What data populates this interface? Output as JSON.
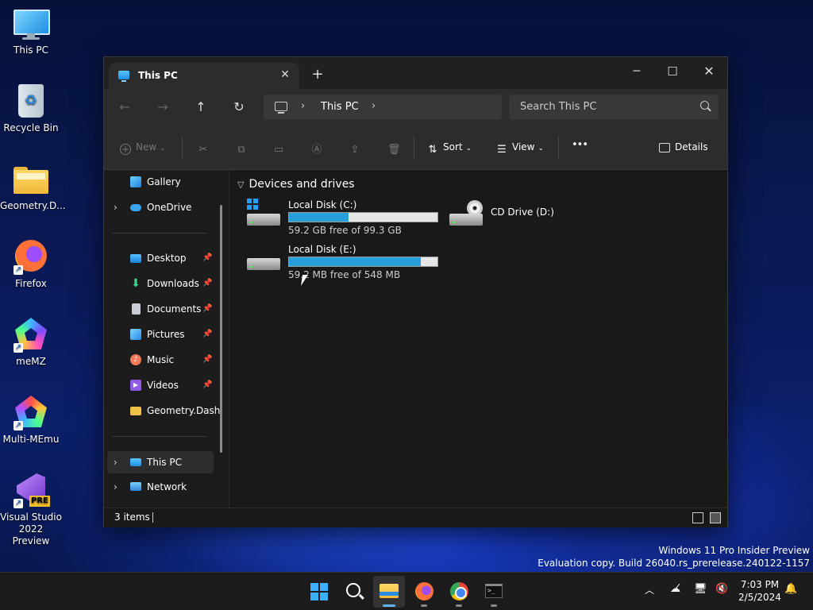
{
  "desktop": {
    "icons": [
      {
        "label": "This PC"
      },
      {
        "label": "Recycle Bin"
      },
      {
        "label": "Geometry.D..."
      },
      {
        "label": "Firefox"
      },
      {
        "label": "meMZ"
      },
      {
        "label": "Multi-MEmu"
      },
      {
        "label": "Visual Studio 2022 Preview",
        "badge": "PRE"
      }
    ],
    "watermark": {
      "line1": "Windows 11 Pro Insider Preview",
      "line2": "Evaluation copy. Build 26040.rs_prerelease.240122-1157"
    }
  },
  "window": {
    "tab_title": "This PC",
    "tab_close": "✕",
    "new_tab": "+",
    "controls": {
      "minimize": "─",
      "maximize": "☐",
      "close": "✕"
    },
    "nav": {
      "back": "←",
      "forward": "→",
      "up": "↑",
      "refresh": "↻"
    },
    "breadcrumb": {
      "sep": "›",
      "location": "This PC"
    },
    "search_placeholder": "Search This PC",
    "commands": {
      "new": "New",
      "sort": "Sort",
      "view": "View",
      "more": "•••",
      "details": "Details"
    },
    "sidebar": {
      "items": [
        {
          "label": "Gallery"
        },
        {
          "label": "OneDrive"
        },
        {
          "label": "Desktop"
        },
        {
          "label": "Downloads"
        },
        {
          "label": "Documents"
        },
        {
          "label": "Pictures"
        },
        {
          "label": "Music"
        },
        {
          "label": "Videos"
        },
        {
          "label": "Geometry.Dash."
        },
        {
          "label": "This PC"
        },
        {
          "label": "Network"
        }
      ]
    },
    "content": {
      "group_title": "Devices and drives",
      "drives": [
        {
          "name": "Local Disk (C:)",
          "detail": "59.2 GB free of 99.3 GB",
          "used_fraction": 0.4
        },
        {
          "name": "CD Drive (D:)"
        },
        {
          "name": "Local Disk (E:)",
          "detail": "59.2 MB free of 548 MB",
          "used_fraction": 0.89
        }
      ]
    },
    "status": {
      "items": "3 items"
    }
  },
  "taskbar": {
    "clock": {
      "time": "7:03 PM",
      "date": "2/5/2024"
    }
  }
}
